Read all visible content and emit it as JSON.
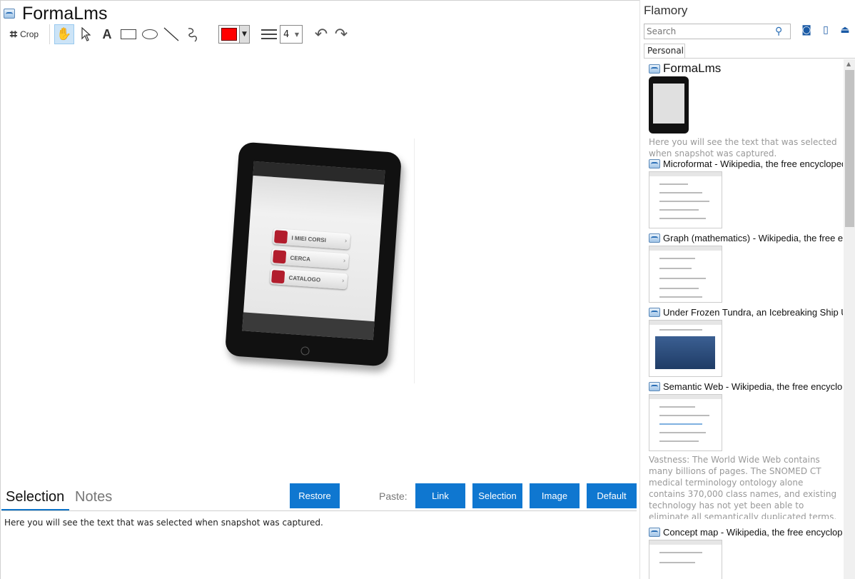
{
  "document": {
    "title": "FormaLms"
  },
  "toolbar": {
    "crop_label": "Crop",
    "stroke_color": "#ff0000",
    "line_width": "4",
    "tools": [
      "hand-tool",
      "pointer-tool",
      "text-tool",
      "rectangle-tool",
      "ellipse-tool",
      "line-tool",
      "freehand-tool"
    ]
  },
  "tablet_screen": {
    "buttons": [
      "I MIEI CORSI",
      "CERCA",
      "CATALOGO"
    ]
  },
  "bottom_panel": {
    "tabs": [
      "Selection",
      "Notes"
    ],
    "active_tab": "Selection",
    "restore_label": "Restore",
    "paste_label": "Paste:",
    "paste_buttons": [
      "Link",
      "Selection",
      "Image",
      "Default"
    ],
    "selection_text": "Here you will see the text that was selected when snapshot was captured.",
    "accent_color": "#0f77d0"
  },
  "sidebar": {
    "app_title": "Flamory",
    "search_placeholder": "Search",
    "tab_label": "Personal",
    "items": [
      {
        "title": "FormaLms",
        "description": "Here you will see the text that was selected when snapshot was captured."
      },
      {
        "title": "Microformat - Wikipedia, the free encyclopedia"
      },
      {
        "title": "Graph (mathematics) - Wikipedia, the free ency"
      },
      {
        "title": "Under Frozen Tundra, an Icebreaking Ship Unco"
      },
      {
        "title": "Semantic Web - Wikipedia, the free encycloped",
        "description": "Vastness: The World Wide Web contains many billions of pages. The SNOMED CT medical terminology ontology alone contains 370,000 class names, and existing technology has not yet been able to eliminate all semantically duplicated terms. Any automated reasoning system will have to deal with truly huge inputs."
      },
      {
        "title": "Concept map - Wikipedia, the free encyclopedia"
      }
    ]
  }
}
